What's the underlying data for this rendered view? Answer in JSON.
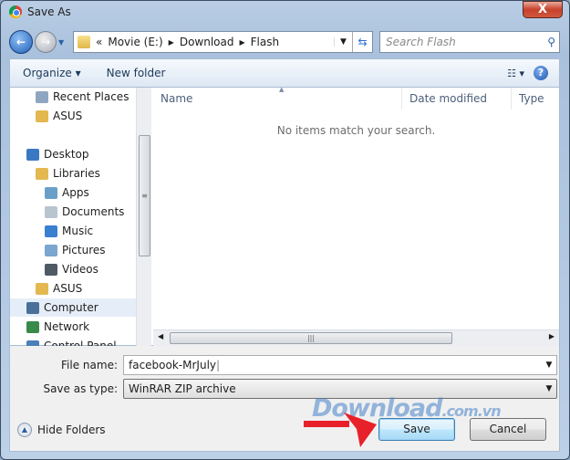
{
  "window": {
    "title": "Save As",
    "close_label": "X"
  },
  "address": {
    "overflow": "«",
    "crumbs": [
      "Movie (E:)",
      "Download",
      "Flash"
    ]
  },
  "search": {
    "placeholder": "Search Flash"
  },
  "toolbar": {
    "organize": "Organize ▾",
    "new_folder": "New folder",
    "views": "☷ ▾",
    "help": "?"
  },
  "sidebar": {
    "items": [
      {
        "label": "Recent Places",
        "icon": "recent-places-icon",
        "color": "#8fa6c0"
      },
      {
        "label": "ASUS",
        "icon": "folder-icon",
        "color": "#e3b84f"
      },
      {
        "label": "Desktop",
        "icon": "desktop-icon",
        "color": "#3a78c4"
      },
      {
        "label": "Libraries",
        "icon": "libraries-icon",
        "color": "#e3b84f"
      },
      {
        "label": "Apps",
        "icon": "apps-icon",
        "color": "#6aa0c8"
      },
      {
        "label": "Documents",
        "icon": "documents-icon",
        "color": "#b8c4d0"
      },
      {
        "label": "Music",
        "icon": "music-icon",
        "color": "#3a7fd0"
      },
      {
        "label": "Pictures",
        "icon": "pictures-icon",
        "color": "#7aa6d0"
      },
      {
        "label": "Videos",
        "icon": "videos-icon",
        "color": "#505a66"
      },
      {
        "label": "ASUS",
        "icon": "user-folder-icon",
        "color": "#e3b84f"
      },
      {
        "label": "Computer",
        "icon": "computer-icon",
        "color": "#4a6f99"
      },
      {
        "label": "Network",
        "icon": "network-icon",
        "color": "#3a8a4a"
      },
      {
        "label": "Control Panel",
        "icon": "control-panel-icon",
        "color": "#4a7fb8"
      }
    ]
  },
  "columns": [
    "Name",
    "Date modified",
    "Type"
  ],
  "empty_message": "No items match your search.",
  "form": {
    "file_name_label": "File name:",
    "file_name_value": "facebook-MrJuly",
    "type_label": "Save as type:",
    "type_value": "WinRAR ZIP archive"
  },
  "hide_folders": "Hide Folders",
  "buttons": {
    "save": "Save",
    "cancel": "Cancel"
  },
  "watermark": "Download.com.vn"
}
